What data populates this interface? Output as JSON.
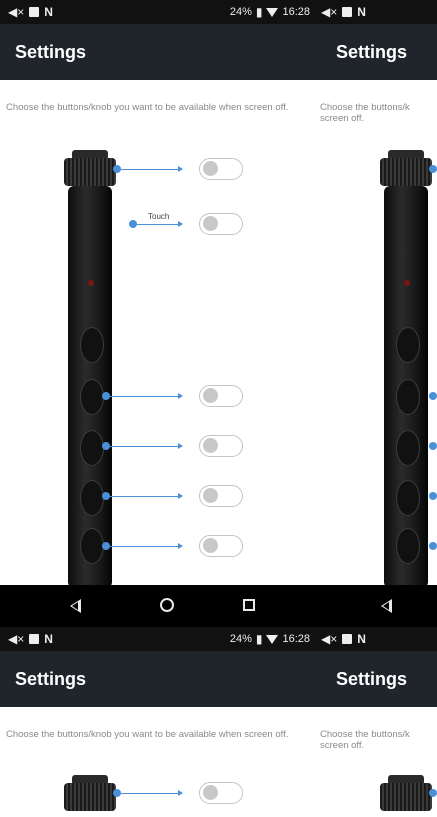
{
  "status_bar": {
    "battery": "24%",
    "time": "16:28"
  },
  "settings_screen": {
    "title": "Settings",
    "description": "Choose the buttons/knob you want to be available when screen off.",
    "touch_label": "Touch",
    "toggles": [
      {
        "target": "knob",
        "enabled": false
      },
      {
        "target": "touch",
        "enabled": false
      },
      {
        "target": "button-1",
        "enabled": false
      },
      {
        "target": "button-2",
        "enabled": false
      },
      {
        "target": "button-3",
        "enabled": false
      },
      {
        "target": "button-4",
        "enabled": false
      }
    ]
  },
  "cropped_panel": {
    "title": "Settings",
    "description": "Choose the buttons/k screen off."
  },
  "icons": {
    "mute": "mute-icon",
    "image_notification": "image-notification-icon",
    "n_notification": "n-notification-icon",
    "battery": "battery-icon",
    "wifi": "wifi-icon",
    "nav_back": "back-triangle-icon",
    "nav_home": "home-circle-icon",
    "nav_recent": "recent-square-icon"
  },
  "colors": {
    "app_bar": "#1f252a",
    "status_bar": "#111111",
    "accent_blue": "#4a90d9",
    "toggle_off": "#c8c8c8",
    "description_text": "#8a8a8a"
  }
}
